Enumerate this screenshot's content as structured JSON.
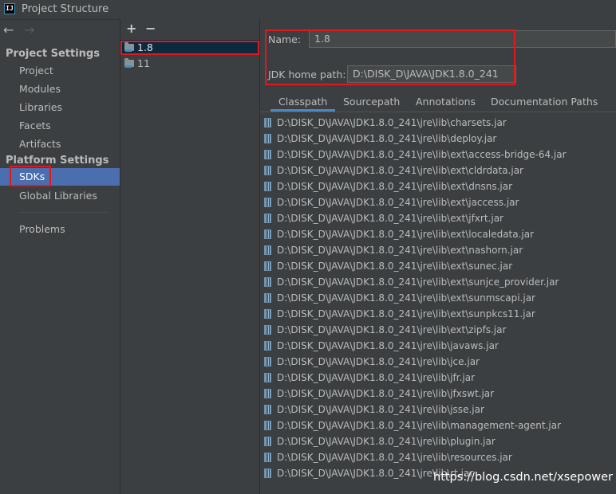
{
  "window": {
    "app_icon_text": "IJ",
    "title": "Project Structure"
  },
  "nav": {
    "back_icon": "←",
    "forward_icon": "→"
  },
  "left": {
    "project_settings_header": "Project Settings",
    "project_items": [
      "Project",
      "Modules",
      "Libraries",
      "Facets",
      "Artifacts"
    ],
    "platform_settings_header": "Platform Settings",
    "platform_items": [
      "SDKs",
      "Global Libraries"
    ],
    "problems": "Problems",
    "selected_item": "SDKs"
  },
  "sdk_list": {
    "add_label": "+",
    "remove_label": "−",
    "items": [
      "1.8",
      "11"
    ],
    "selected": "1.8"
  },
  "detail": {
    "name_label": "Name:",
    "name_value": "1.8",
    "home_label": "JDK home path:",
    "home_value": "D:\\DISK_D\\JAVA\\JDK1.8.0_241",
    "tabs": [
      "Classpath",
      "Sourcepath",
      "Annotations",
      "Documentation Paths"
    ],
    "active_tab": "Classpath"
  },
  "classpath": [
    "D:\\DISK_D\\JAVA\\JDK1.8.0_241\\jre\\lib\\charsets.jar",
    "D:\\DISK_D\\JAVA\\JDK1.8.0_241\\jre\\lib\\deploy.jar",
    "D:\\DISK_D\\JAVA\\JDK1.8.0_241\\jre\\lib\\ext\\access-bridge-64.jar",
    "D:\\DISK_D\\JAVA\\JDK1.8.0_241\\jre\\lib\\ext\\cldrdata.jar",
    "D:\\DISK_D\\JAVA\\JDK1.8.0_241\\jre\\lib\\ext\\dnsns.jar",
    "D:\\DISK_D\\JAVA\\JDK1.8.0_241\\jre\\lib\\ext\\jaccess.jar",
    "D:\\DISK_D\\JAVA\\JDK1.8.0_241\\jre\\lib\\ext\\jfxrt.jar",
    "D:\\DISK_D\\JAVA\\JDK1.8.0_241\\jre\\lib\\ext\\localedata.jar",
    "D:\\DISK_D\\JAVA\\JDK1.8.0_241\\jre\\lib\\ext\\nashorn.jar",
    "D:\\DISK_D\\JAVA\\JDK1.8.0_241\\jre\\lib\\ext\\sunec.jar",
    "D:\\DISK_D\\JAVA\\JDK1.8.0_241\\jre\\lib\\ext\\sunjce_provider.jar",
    "D:\\DISK_D\\JAVA\\JDK1.8.0_241\\jre\\lib\\ext\\sunmscapi.jar",
    "D:\\DISK_D\\JAVA\\JDK1.8.0_241\\jre\\lib\\ext\\sunpkcs11.jar",
    "D:\\DISK_D\\JAVA\\JDK1.8.0_241\\jre\\lib\\ext\\zipfs.jar",
    "D:\\DISK_D\\JAVA\\JDK1.8.0_241\\jre\\lib\\javaws.jar",
    "D:\\DISK_D\\JAVA\\JDK1.8.0_241\\jre\\lib\\jce.jar",
    "D:\\DISK_D\\JAVA\\JDK1.8.0_241\\jre\\lib\\jfr.jar",
    "D:\\DISK_D\\JAVA\\JDK1.8.0_241\\jre\\lib\\jfxswt.jar",
    "D:\\DISK_D\\JAVA\\JDK1.8.0_241\\jre\\lib\\jsse.jar",
    "D:\\DISK_D\\JAVA\\JDK1.8.0_241\\jre\\lib\\management-agent.jar",
    "D:\\DISK_D\\JAVA\\JDK1.8.0_241\\jre\\lib\\plugin.jar",
    "D:\\DISK_D\\JAVA\\JDK1.8.0_241\\jre\\lib\\resources.jar",
    "D:\\DISK_D\\JAVA\\JDK1.8.0_241\\jre\\lib\\rt.jar"
  ],
  "watermark": "https://blog.csdn.net/xsepower",
  "colors": {
    "background": "#3c3f41",
    "selection": "#4b6eaf",
    "list_selection": "#0d293e",
    "annotation_red": "#e0191d",
    "tab_underline": "#4a88c7"
  }
}
